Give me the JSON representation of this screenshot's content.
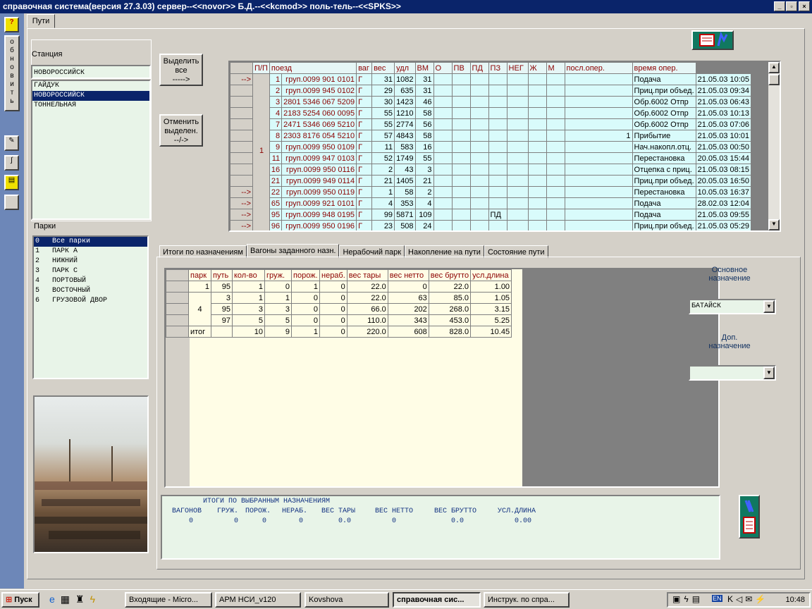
{
  "window": {
    "title": "справочная система(версия 27.3.03) сервер--<<novor>> Б.Д.--<<kcmod>> поль-тель--<<SPKS>>"
  },
  "left_toolbar": {
    "help_label": "?",
    "refresh_label": "обновить"
  },
  "tabs": {
    "main": "Пути"
  },
  "station": {
    "label": "Станция",
    "value": "НОВОРОССИЙСК",
    "items": [
      "ГАЙДУК",
      "НОВОРОССИЙСК",
      "ТОННЕЛЬНАЯ"
    ]
  },
  "parks": {
    "label": "Парки",
    "items": [
      {
        "num": "0",
        "name": "Все парки"
      },
      {
        "num": "1",
        "name": "ПАРК А"
      },
      {
        "num": "2",
        "name": "НИЖНИЙ"
      },
      {
        "num": "3",
        "name": "ПАРК С"
      },
      {
        "num": "4",
        "name": "ПОРТОВЫЙ"
      },
      {
        "num": "5",
        "name": "ВОСТОЧНЫЙ"
      },
      {
        "num": "6",
        "name": "ГРУЗОВОЙ ДВОР"
      }
    ]
  },
  "buttons": {
    "select_all": [
      "Выделить",
      "все",
      "----->"
    ],
    "cancel_select": [
      "Отменить",
      "выделен.",
      "--/->"
    ]
  },
  "trains": {
    "headers": [
      "П/П",
      "поезд",
      "ваг",
      "вес",
      "удл",
      "ВМ",
      "О",
      "ПВ",
      "ПД",
      "ПЗ",
      "НЕГ",
      "Ж",
      "М",
      "посл.опер.",
      "время опер."
    ],
    "group_label": "1",
    "rows": [
      {
        "mark": "-->",
        "pp": "1",
        "train": "груп.0099 901 0101",
        "g": "Г",
        "vag": "31",
        "ves": "1082",
        "udl": "31",
        "vm": "",
        "o": "",
        "pv": "",
        "pd": "",
        "pz": "",
        "neg": "",
        "zh": "",
        "m": "",
        "op": "Подача",
        "time": "21.05.03 10:05"
      },
      {
        "mark": "",
        "pp": "2",
        "train": "груп.0099 945 0102",
        "g": "Г",
        "vag": "29",
        "ves": "635",
        "udl": "31",
        "vm": "",
        "o": "",
        "pv": "",
        "pd": "",
        "pz": "",
        "neg": "",
        "zh": "",
        "m": "",
        "op": "Приц.при объед.",
        "time": "21.05.03 09:34"
      },
      {
        "mark": "",
        "pp": "3",
        "train": "2801 5346 067 5209",
        "g": "Г",
        "vag": "30",
        "ves": "1423",
        "udl": "46",
        "vm": "",
        "o": "",
        "pv": "",
        "pd": "",
        "pz": "",
        "neg": "",
        "zh": "",
        "m": "",
        "op": "Обр.6002 Отпр",
        "time": "21.05.03 06:43"
      },
      {
        "mark": "",
        "pp": "4",
        "train": "2183 5254 060 0095",
        "g": "Г",
        "vag": "55",
        "ves": "1210",
        "udl": "58",
        "vm": "",
        "o": "",
        "pv": "",
        "pd": "",
        "pz": "",
        "neg": "",
        "zh": "",
        "m": "",
        "op": "Обр.6002 Отпр",
        "time": "21.05.03 10:13"
      },
      {
        "mark": "",
        "pp": "7",
        "train": "2471 5346 069 5210",
        "g": "Г",
        "vag": "55",
        "ves": "2774",
        "udl": "56",
        "vm": "",
        "o": "",
        "pv": "",
        "pd": "",
        "pz": "",
        "neg": "",
        "zh": "",
        "m": "",
        "op": "Обр.6002 Отпр",
        "time": "21.05.03 07:06"
      },
      {
        "mark": "",
        "pp": "8",
        "train": "2303 8176 054 5210",
        "g": "Г",
        "vag": "57",
        "ves": "4843",
        "udl": "58",
        "vm": "",
        "o": "",
        "pv": "",
        "pd": "",
        "pz": "",
        "neg": "",
        "zh": "",
        "m": "1",
        "op": "Прибытие",
        "time": "21.05.03 10:01"
      },
      {
        "mark": "",
        "pp": "9",
        "train": "груп.0099 950 0109",
        "g": "Г",
        "vag": "11",
        "ves": "583",
        "udl": "16",
        "vm": "",
        "o": "",
        "pv": "",
        "pd": "",
        "pz": "",
        "neg": "",
        "zh": "",
        "m": "",
        "op": "Нач.накопл.отц.",
        "time": "21.05.03 00:50"
      },
      {
        "mark": "",
        "pp": "11",
        "train": "груп.0099 947 0103",
        "g": "Г",
        "vag": "52",
        "ves": "1749",
        "udl": "55",
        "vm": "",
        "o": "",
        "pv": "",
        "pd": "",
        "pz": "",
        "neg": "",
        "zh": "",
        "m": "",
        "op": "Перестановка",
        "time": "20.05.03 15:44"
      },
      {
        "mark": "",
        "pp": "16",
        "train": "груп.0099 950 0116",
        "g": "Г",
        "vag": "2",
        "ves": "43",
        "udl": "3",
        "vm": "",
        "o": "",
        "pv": "",
        "pd": "",
        "pz": "",
        "neg": "",
        "zh": "",
        "m": "",
        "op": "Отцепка с приц.",
        "time": "21.05.03 08:15"
      },
      {
        "mark": "",
        "pp": "21",
        "train": "груп.0099 949 0114",
        "g": "Г",
        "vag": "21",
        "ves": "1405",
        "udl": "21",
        "vm": "",
        "o": "",
        "pv": "",
        "pd": "",
        "pz": "",
        "neg": "",
        "zh": "",
        "m": "",
        "op": "Приц.при объед.",
        "time": "20.05.03 16:50"
      },
      {
        "mark": "-->",
        "pp": "22",
        "train": "груп.0099 950 0119",
        "g": "Г",
        "vag": "1",
        "ves": "58",
        "udl": "2",
        "vm": "",
        "o": "",
        "pv": "",
        "pd": "",
        "pz": "",
        "neg": "",
        "zh": "",
        "m": "",
        "op": "Перестановка",
        "time": "10.05.03 16:37"
      },
      {
        "mark": "-->",
        "pp": "65",
        "train": "груп.0099 921 0101",
        "g": "Г",
        "vag": "4",
        "ves": "353",
        "udl": "4",
        "vm": "",
        "o": "",
        "pv": "",
        "pd": "",
        "pz": "",
        "neg": "",
        "zh": "",
        "m": "",
        "op": "Подача",
        "time": "28.02.03 12:04"
      },
      {
        "mark": "-->",
        "pp": "95",
        "train": "груп.0099 948 0195",
        "g": "Г",
        "vag": "99",
        "ves": "5871",
        "udl": "109",
        "vm": "",
        "o": "",
        "pv": "",
        "pd": "ПД",
        "pz": "",
        "neg": "",
        "zh": "",
        "m": "",
        "op": "Подача",
        "time": "21.05.03 09:55"
      },
      {
        "mark": "-->",
        "pp": "96",
        "train": "груп.0099 950 0196",
        "g": "Г",
        "vag": "23",
        "ves": "508",
        "udl": "24",
        "vm": "",
        "o": "",
        "pv": "",
        "pd": "",
        "pz": "",
        "neg": "",
        "zh": "",
        "m": "",
        "op": "Приц.при объед.",
        "time": "21.05.03 05:29"
      }
    ]
  },
  "subtabs": [
    "Итоги по назначениям",
    "Вагоны заданного назн.",
    "Нерабочий парк",
    "Накопление на пути",
    "Состояние пути"
  ],
  "summary": {
    "headers": [
      "парк",
      "путь",
      "кол-во",
      "груж.",
      "порож.",
      "нераб.",
      "вес тары",
      "вес нетто",
      "вес брутто",
      "усл.длина"
    ],
    "rows": [
      {
        "park": "1",
        "put": "95",
        "kol": "1",
        "gruzh": "0",
        "porozh": "1",
        "nerab": "0",
        "tara": "22.0",
        "netto": "0",
        "brutto": "22.0",
        "dl": "1.00"
      },
      {
        "park": "4",
        "put": "3",
        "kol": "1",
        "gruzh": "1",
        "porozh": "0",
        "nerab": "0",
        "tara": "22.0",
        "netto": "63",
        "brutto": "85.0",
        "dl": "1.05"
      },
      {
        "park": "",
        "put": "95",
        "kol": "3",
        "gruzh": "3",
        "porozh": "0",
        "nerab": "0",
        "tara": "66.0",
        "netto": "202",
        "brutto": "268.0",
        "dl": "3.15"
      },
      {
        "park": "",
        "put": "97",
        "kol": "5",
        "gruzh": "5",
        "porozh": "0",
        "nerab": "0",
        "tara": "110.0",
        "netto": "343",
        "brutto": "453.0",
        "dl": "5.25"
      },
      {
        "park": "итог",
        "put": "",
        "kol": "10",
        "gruzh": "9",
        "porozh": "1",
        "nerab": "0",
        "tara": "220.0",
        "netto": "608",
        "brutto": "828.0",
        "dl": "10.45"
      }
    ]
  },
  "destination": {
    "main_label": [
      "Основное",
      "назначение"
    ],
    "main_value": "БАТАЙСК",
    "extra_label": [
      "Доп.",
      "назначение"
    ],
    "extra_value": ""
  },
  "totals": {
    "title": "ИТОГИ ПО ВЫБРАННЫМ НАЗНАЧЕНИЯМ",
    "labels": [
      "ВАГОНОВ",
      "ГРУЖ.",
      "ПОРОЖ.",
      "НЕРАБ.",
      "ВЕС ТАРЫ",
      "ВЕС НЕТТО",
      "ВЕС БРУТТО",
      "УСЛ.ДЛИНА"
    ],
    "values": [
      "0",
      "0",
      "0",
      "0",
      "0.0",
      "0",
      "0.0",
      "0.00"
    ]
  },
  "taskbar": {
    "start": "Пуск",
    "clock": "10:48",
    "lang": "EN",
    "tasks": [
      "Входящие - Micro...",
      "АРМ НСИ_v120",
      "Kovshova",
      "справочная сис...",
      "Инструк. по спра..."
    ]
  }
}
